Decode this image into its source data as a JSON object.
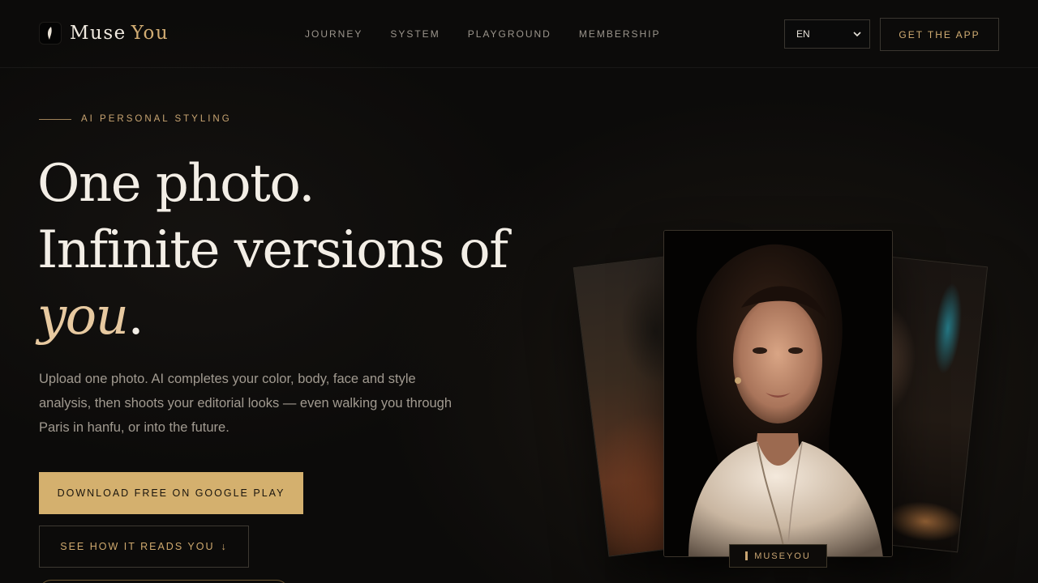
{
  "brand": {
    "name_primary": "Muse",
    "name_accent": "You"
  },
  "nav": {
    "items": [
      "JOURNEY",
      "SYSTEM",
      "PLAYGROUND",
      "MEMBERSHIP"
    ]
  },
  "header": {
    "language": "EN",
    "cta_label": "GET THE APP"
  },
  "hero": {
    "eyebrow": "AI PERSONAL STYLING",
    "headline_line1": "One photo.",
    "headline_line2": "Infinite versions of",
    "headline_accent": "you",
    "headline_end": ".",
    "subtext": "Upload one photo. AI completes your color, body, face and style analysis, then shoots your editorial looks — even walking you through Paris in hanfu, or into the future.",
    "primary_button": "DOWNLOAD FREE ON GOOGLE PLAY",
    "secondary_button": "SEE HOW IT READS YOU",
    "secondary_arrow": "↓"
  },
  "gallery": {
    "tag_label": "MUSEYOU"
  },
  "colors": {
    "accent": "#d4b06e",
    "background": "#0c0b0a",
    "text": "#f3eee6"
  },
  "icons": {
    "logo": "feather-logo-icon",
    "dropdown": "chevron-down-icon",
    "arrow": "arrow-down-icon"
  }
}
